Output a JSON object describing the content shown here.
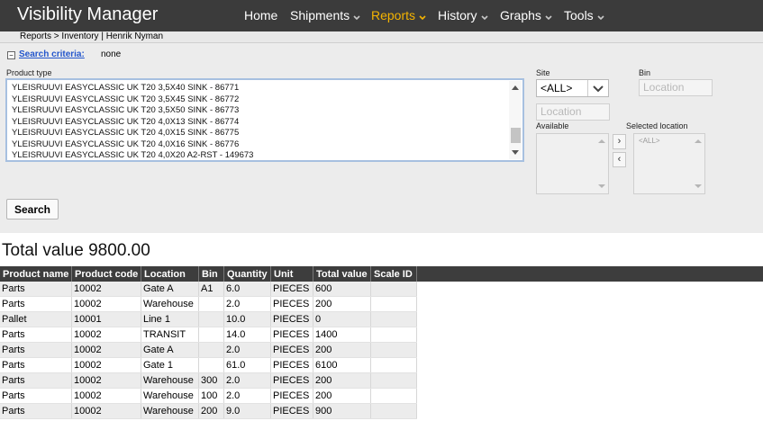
{
  "app": {
    "title": "Visibility Manager"
  },
  "nav": [
    {
      "label": "Home",
      "has_dropdown": false,
      "active": false
    },
    {
      "label": "Shipments",
      "has_dropdown": true,
      "active": false
    },
    {
      "label": "Reports",
      "has_dropdown": true,
      "active": true
    },
    {
      "label": "History",
      "has_dropdown": true,
      "active": false
    },
    {
      "label": "Graphs",
      "has_dropdown": true,
      "active": false
    },
    {
      "label": "Tools",
      "has_dropdown": true,
      "active": false
    }
  ],
  "breadcrumb": "Reports > Inventory | Henrik Nyman",
  "search": {
    "criteria_label": "Search criteria:",
    "criteria_value": "none",
    "product_type_label": "Product type",
    "product_types": [
      "YLEISRUUVI EASYCLASSIC UK T20 3,5X40 SINK - 86771",
      "YLEISRUUVI EASYCLASSIC UK T20 3,5X45 SINK - 86772",
      "YLEISRUUVI EASYCLASSIC UK T20 3,5X50 SINK - 86773",
      "YLEISRUUVI EASYCLASSIC UK T20 4,0X13 SINK - 86774",
      "YLEISRUUVI EASYCLASSIC UK T20 4,0X15 SINK - 86775",
      "YLEISRUUVI EASYCLASSIC UK T20 4,0X16 SINK - 86776",
      "YLEISRUUVI EASYCLASSIC UK T20 4,0X20 A2-RST - 149673"
    ],
    "site_label": "Site",
    "site_value": "<ALL>",
    "bin_label": "Bin",
    "bin_placeholder": "Location",
    "location_placeholder": "Location",
    "available_label": "Available",
    "selected_location_label": "Selected location",
    "selected_location_items": [
      "<ALL>"
    ],
    "move_right": "›",
    "move_left": "‹",
    "search_button": "Search"
  },
  "total": "Total value 9800.00",
  "table": {
    "columns": [
      "Product name",
      "Product code",
      "Location",
      "Bin",
      "Quantity",
      "Unit",
      "Total value",
      "Scale ID"
    ],
    "rows": [
      [
        "Parts",
        "10002",
        "Gate A",
        "A1",
        "6.0",
        "PIECES",
        "600",
        ""
      ],
      [
        "Parts",
        "10002",
        "Warehouse",
        "",
        "2.0",
        "PIECES",
        "200",
        ""
      ],
      [
        "Pallet",
        "10001",
        "Line 1",
        "",
        "10.0",
        "PIECES",
        "0",
        ""
      ],
      [
        "Parts",
        "10002",
        "TRANSIT",
        "",
        "14.0",
        "PIECES",
        "1400",
        ""
      ],
      [
        "Parts",
        "10002",
        "Gate A",
        "",
        "2.0",
        "PIECES",
        "200",
        ""
      ],
      [
        "Parts",
        "10002",
        "Gate 1",
        "",
        "61.0",
        "PIECES",
        "6100",
        ""
      ],
      [
        "Parts",
        "10002",
        "Warehouse",
        "300",
        "2.0",
        "PIECES",
        "200",
        ""
      ],
      [
        "Parts",
        "10002",
        "Warehouse",
        "100",
        "2.0",
        "PIECES",
        "200",
        ""
      ],
      [
        "Parts",
        "10002",
        "Warehouse",
        "200",
        "9.0",
        "PIECES",
        "900",
        ""
      ]
    ]
  },
  "colors": {
    "topbar": "#3b3b3b",
    "active_nav": "#f5b400",
    "link": "#2255cc",
    "table_header": "#3d3d3d"
  }
}
